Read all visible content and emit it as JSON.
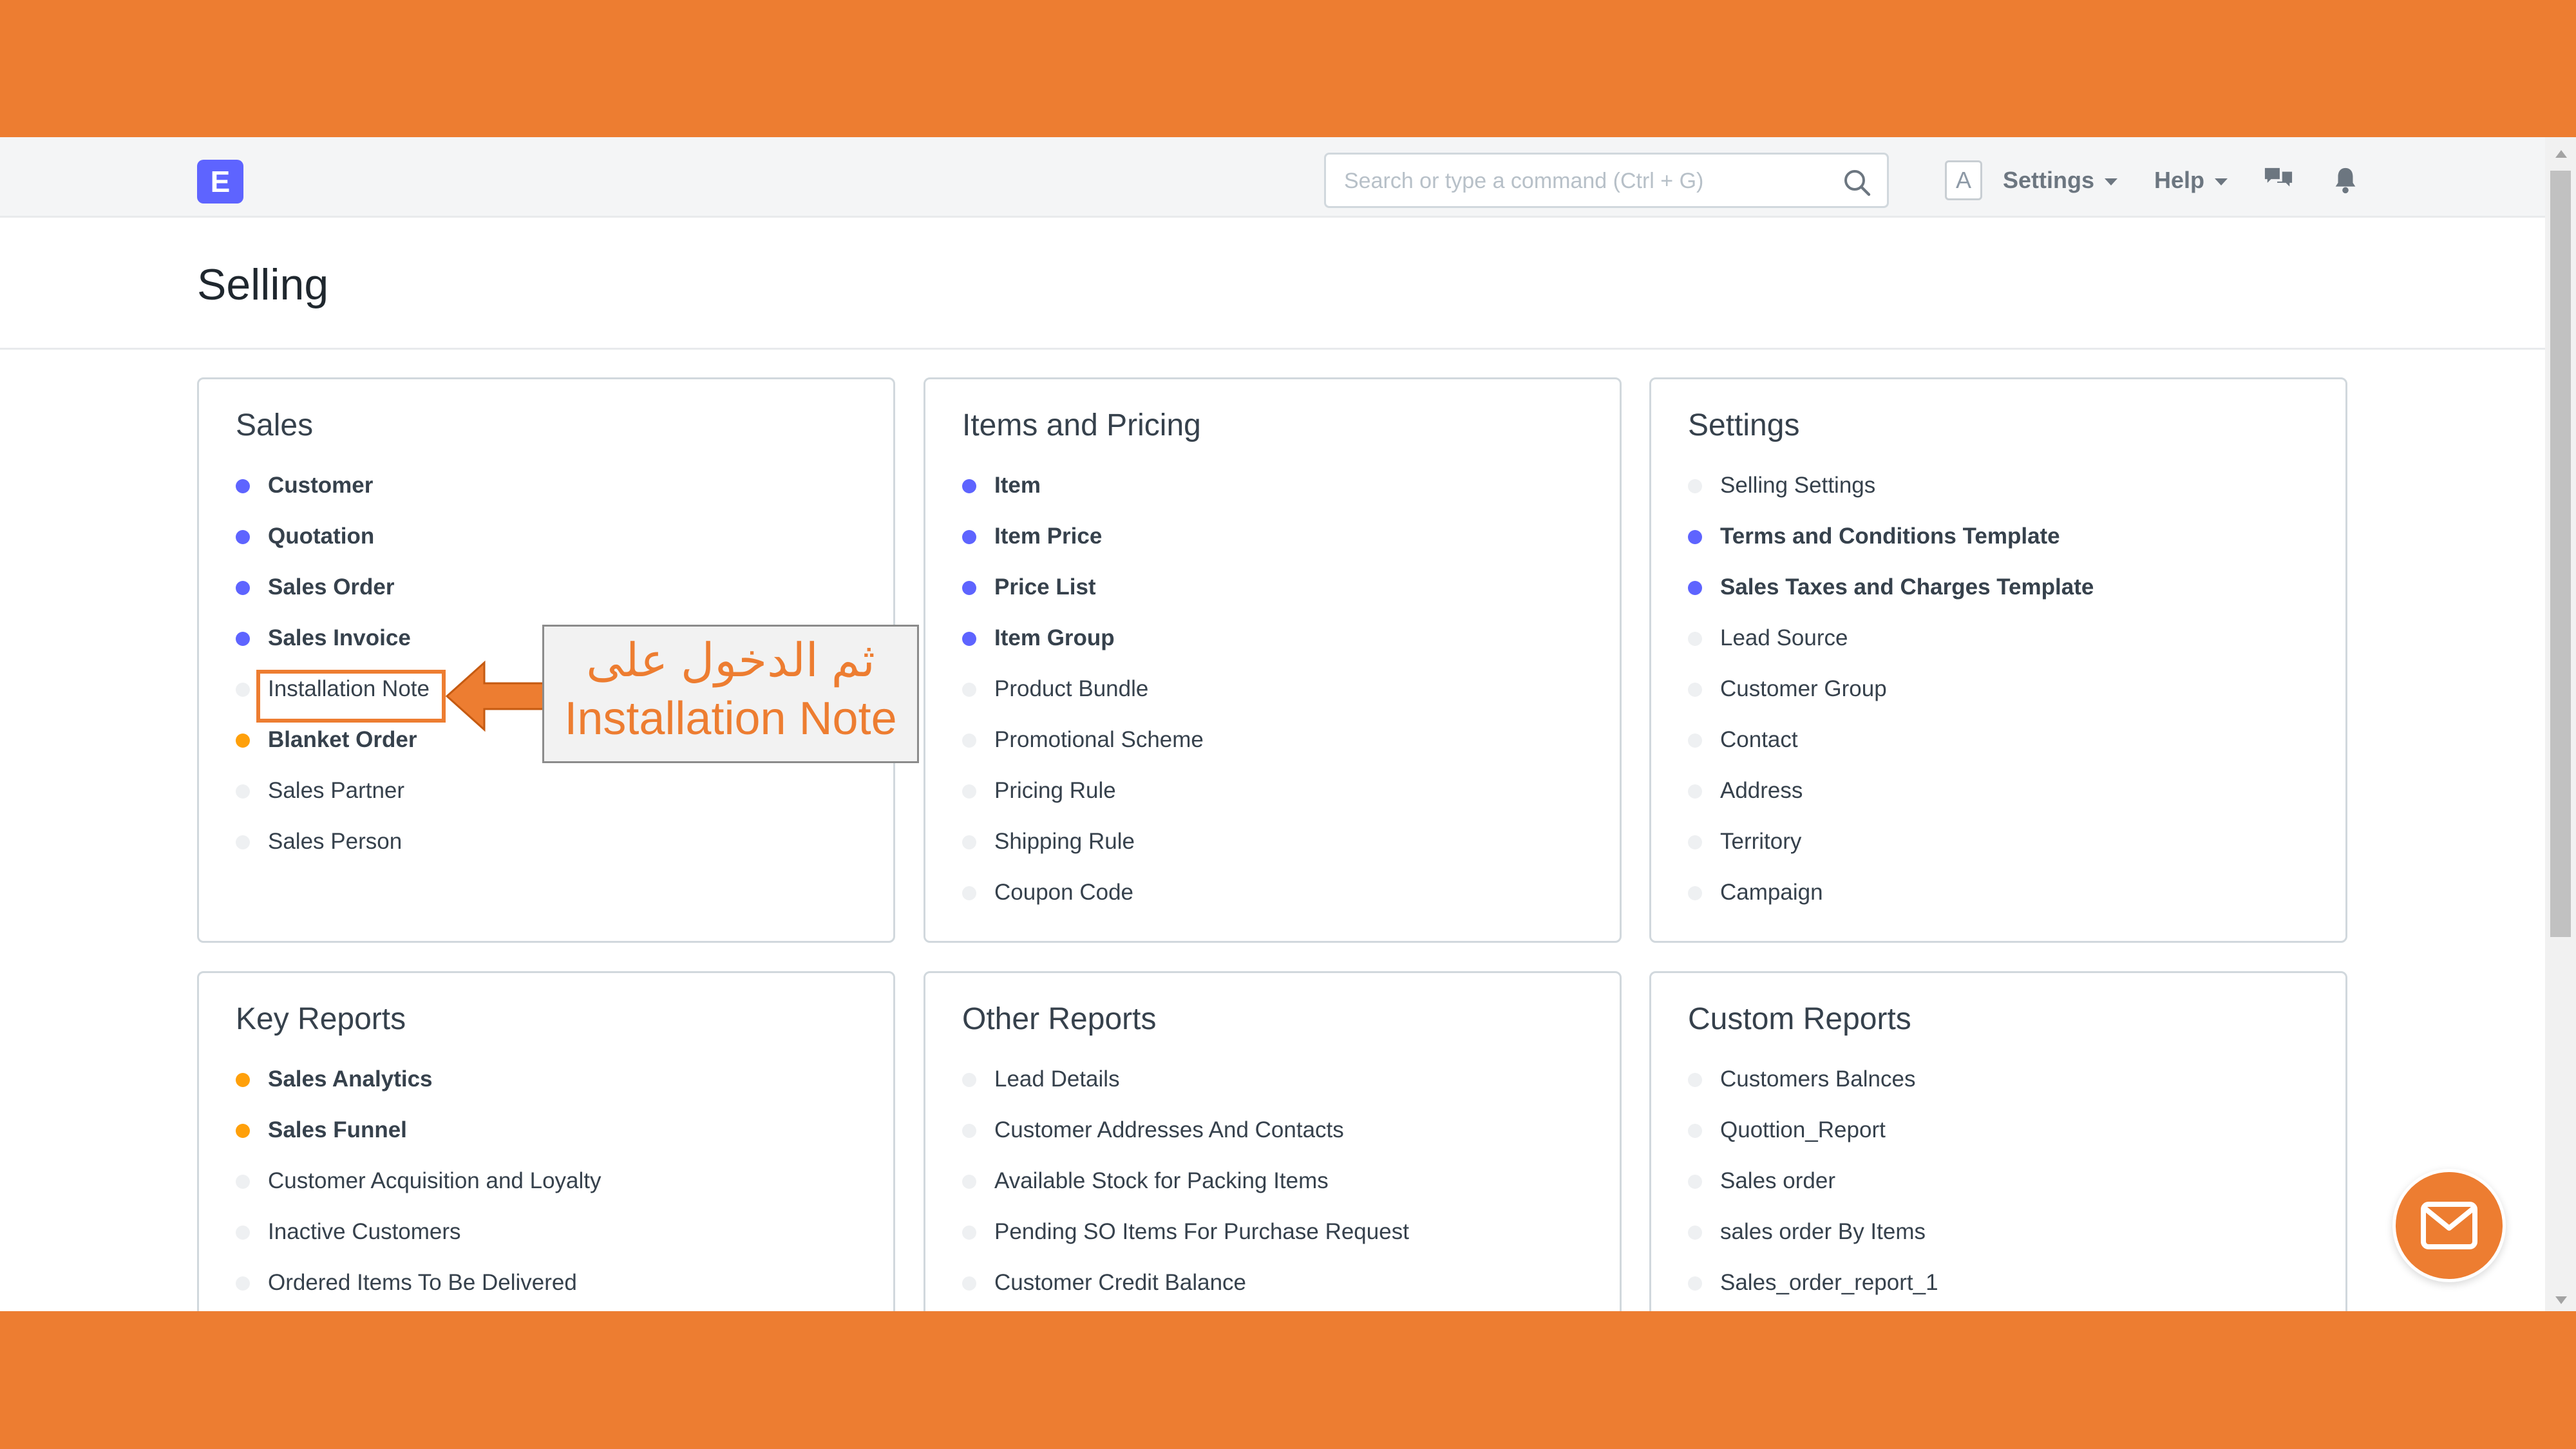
{
  "navbar": {
    "logo_letter": "E",
    "search_placeholder": "Search or type a command (Ctrl + G)",
    "avatar_letter": "A",
    "settings_label": "Settings",
    "help_label": "Help"
  },
  "page": {
    "title": "Selling"
  },
  "cards": {
    "sales": {
      "title": "Sales",
      "items": [
        {
          "label": "Customer",
          "dot": "blue"
        },
        {
          "label": "Quotation",
          "dot": "blue"
        },
        {
          "label": "Sales Order",
          "dot": "blue"
        },
        {
          "label": "Sales Invoice",
          "dot": "blue"
        },
        {
          "label": "Installation Note",
          "dot": "none"
        },
        {
          "label": "Blanket Order",
          "dot": "orange"
        },
        {
          "label": "Sales Partner",
          "dot": "none"
        },
        {
          "label": "Sales Person",
          "dot": "none"
        }
      ]
    },
    "items_pricing": {
      "title": "Items and Pricing",
      "items": [
        {
          "label": "Item",
          "dot": "blue"
        },
        {
          "label": "Item Price",
          "dot": "blue"
        },
        {
          "label": "Price List",
          "dot": "blue"
        },
        {
          "label": "Item Group",
          "dot": "blue"
        },
        {
          "label": "Product Bundle",
          "dot": "none"
        },
        {
          "label": "Promotional Scheme",
          "dot": "none"
        },
        {
          "label": "Pricing Rule",
          "dot": "none"
        },
        {
          "label": "Shipping Rule",
          "dot": "none"
        },
        {
          "label": "Coupon Code",
          "dot": "none"
        }
      ]
    },
    "settings": {
      "title": "Settings",
      "items": [
        {
          "label": "Selling Settings",
          "dot": "none"
        },
        {
          "label": "Terms and Conditions Template",
          "dot": "blue"
        },
        {
          "label": "Sales Taxes and Charges Template",
          "dot": "blue"
        },
        {
          "label": "Lead Source",
          "dot": "none"
        },
        {
          "label": "Customer Group",
          "dot": "none"
        },
        {
          "label": "Contact",
          "dot": "none"
        },
        {
          "label": "Address",
          "dot": "none"
        },
        {
          "label": "Territory",
          "dot": "none"
        },
        {
          "label": "Campaign",
          "dot": "none"
        }
      ]
    },
    "key_reports": {
      "title": "Key Reports",
      "items": [
        {
          "label": "Sales Analytics",
          "dot": "orange"
        },
        {
          "label": "Sales Funnel",
          "dot": "orange"
        },
        {
          "label": "Customer Acquisition and Loyalty",
          "dot": "none"
        },
        {
          "label": "Inactive Customers",
          "dot": "none"
        },
        {
          "label": "Ordered Items To Be Delivered",
          "dot": "none"
        }
      ]
    },
    "other_reports": {
      "title": "Other Reports",
      "items": [
        {
          "label": "Lead Details",
          "dot": "none"
        },
        {
          "label": "Customer Addresses And Contacts",
          "dot": "none"
        },
        {
          "label": "Available Stock for Packing Items",
          "dot": "none"
        },
        {
          "label": "Pending SO Items For Purchase Request",
          "dot": "none"
        },
        {
          "label": "Customer Credit Balance",
          "dot": "none"
        }
      ]
    },
    "custom_reports": {
      "title": "Custom Reports",
      "items": [
        {
          "label": "Customers Balnces",
          "dot": "none"
        },
        {
          "label": "Quottion_Report",
          "dot": "none"
        },
        {
          "label": "Sales order",
          "dot": "none"
        },
        {
          "label": "sales order By Items",
          "dot": "none"
        },
        {
          "label": "Sales_order_report_1",
          "dot": "none"
        }
      ]
    }
  },
  "annotation": {
    "line_arabic": "ثم الدخول على",
    "line_english": "Installation Note"
  },
  "colors": {
    "frame": "#ED7D31",
    "dot_blue": "#5E64FF",
    "dot_orange": "#FFA00A",
    "dot_none": "#EEF0F2"
  },
  "icons": [
    "search-icon",
    "chevron-down-icon",
    "chat-icon",
    "bell-icon",
    "mail-icon"
  ]
}
